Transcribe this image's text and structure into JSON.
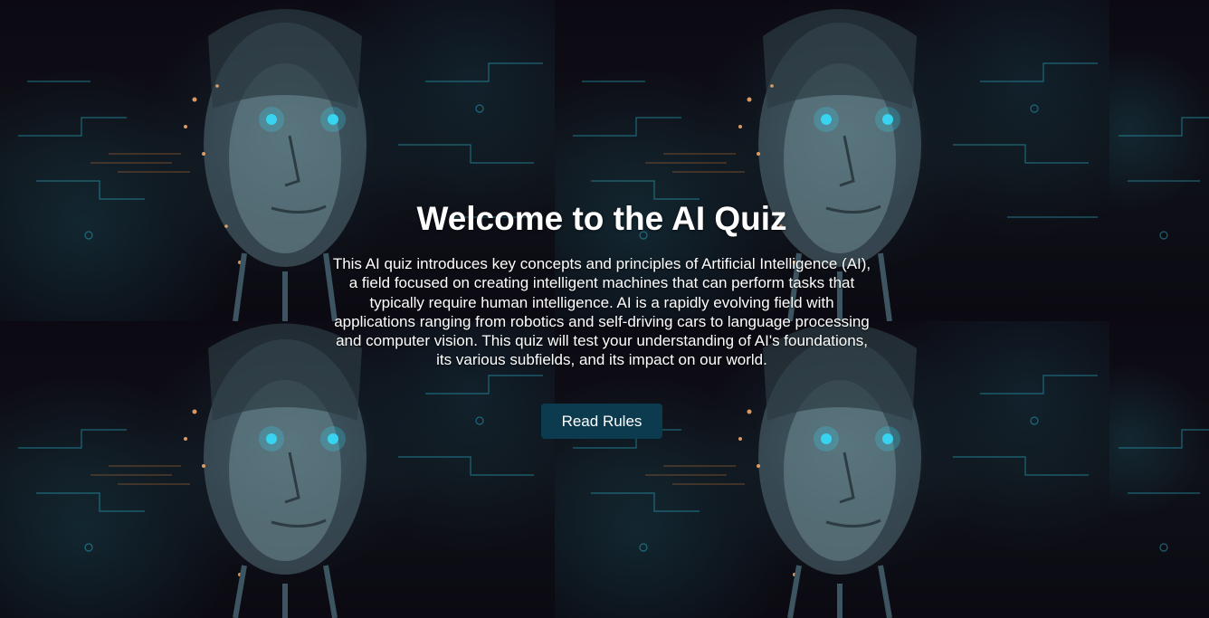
{
  "hero": {
    "title": "Welcome to the AI Quiz",
    "description": "This AI quiz introduces key concepts and principles of Artificial Intelligence (AI), a field focused on creating intelligent machines that can perform tasks that typically require human intelligence. AI is a rapidly evolving field with applications ranging from robotics and self-driving cars to language processing and computer vision. This quiz will test your understanding of AI's foundations, its various subfields, and its impact on our world.",
    "button_label": "Read Rules"
  },
  "colors": {
    "button_bg": "#0c3a4e",
    "text": "#ffffff",
    "page_bg": "#0a0710",
    "glow": "#39d3f0"
  }
}
